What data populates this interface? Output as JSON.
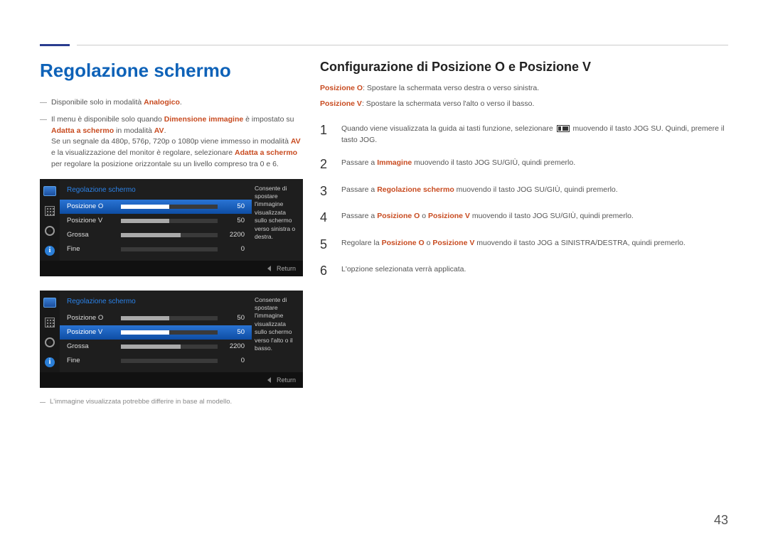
{
  "page_number": "43",
  "left": {
    "title": "Regolazione schermo",
    "bullet1_pre": "Disponibile solo in modalità ",
    "bullet1_hl": "Analogico",
    "bullet1_post": ".",
    "bullet2_a": "Il menu è disponibile solo quando ",
    "bullet2_hl1": "Dimensione immagine",
    "bullet2_b": " è impostato su ",
    "bullet2_hl2": "Adatta a schermo",
    "bullet2_c": " in modalità ",
    "bullet2_hl3": "AV",
    "bullet2_d": ".",
    "bullet2_line2a": "Se un segnale da 480p, 576p, 720p o 1080p viene immesso in modalità ",
    "bullet2_line2hl": "AV",
    "bullet2_line2b": " e la visualizzazione del monitor è regolare, selezionare ",
    "bullet2_line2hl2": "Adatta a schermo",
    "bullet2_line2c": " per regolare la posizione orizzontale su un livello compreso tra 0 e 6.",
    "footnote": "L'immagine visualizzata potrebbe differire in base al modello."
  },
  "osd": {
    "title": "Regolazione schermo",
    "rows": [
      {
        "label": "Posizione O",
        "value": "50",
        "fill": 50
      },
      {
        "label": "Posizione V",
        "value": "50",
        "fill": 50
      },
      {
        "label": "Grossa",
        "value": "2200",
        "fill": 62
      },
      {
        "label": "Fine",
        "value": "0",
        "fill": 0
      }
    ],
    "desc1": "Consente di spostare l'immagine visualizzata sullo schermo verso sinistra o destra.",
    "desc2": "Consente di spostare l'immagine visualizzata sullo schermo verso l'alto o il basso.",
    "return": "Return",
    "info_glyph": "i"
  },
  "right": {
    "title": "Configurazione di Posizione O e Posizione V",
    "line1_hl": "Posizione O",
    "line1_txt": ": Spostare la schermata verso destra o verso sinistra.",
    "line2_hl": "Posizione V",
    "line2_txt": ": Spostare la schermata verso l'alto o verso il basso.",
    "steps": [
      {
        "n": "1",
        "pre": "Quando viene visualizzata la guida ai tasti funzione, selezionare ",
        "post": " muovendo il tasto JOG SU. Quindi, premere il tasto JOG.",
        "icon": true
      },
      {
        "n": "2",
        "pre": "Passare a ",
        "hl": "Immagine",
        "post": " muovendo il tasto JOG SU/GIÙ, quindi premerlo."
      },
      {
        "n": "3",
        "pre": "Passare a ",
        "hl": "Regolazione schermo",
        "post": " muovendo il tasto JOG SU/GIÙ, quindi premerlo."
      },
      {
        "n": "4",
        "pre": "Passare a ",
        "hl": "Posizione O",
        "mid": " o ",
        "hl2": "Posizione V",
        "post": " muovendo il tasto JOG SU/GIÙ, quindi premerlo."
      },
      {
        "n": "5",
        "pre": "Regolare la ",
        "hl": "Posizione O",
        "mid": " o ",
        "hl2": "Posizione V",
        "post": " muovendo il tasto JOG a SINISTRA/DESTRA, quindi premerlo."
      },
      {
        "n": "6",
        "pre": "L'opzione selezionata verrà applicata."
      }
    ]
  }
}
